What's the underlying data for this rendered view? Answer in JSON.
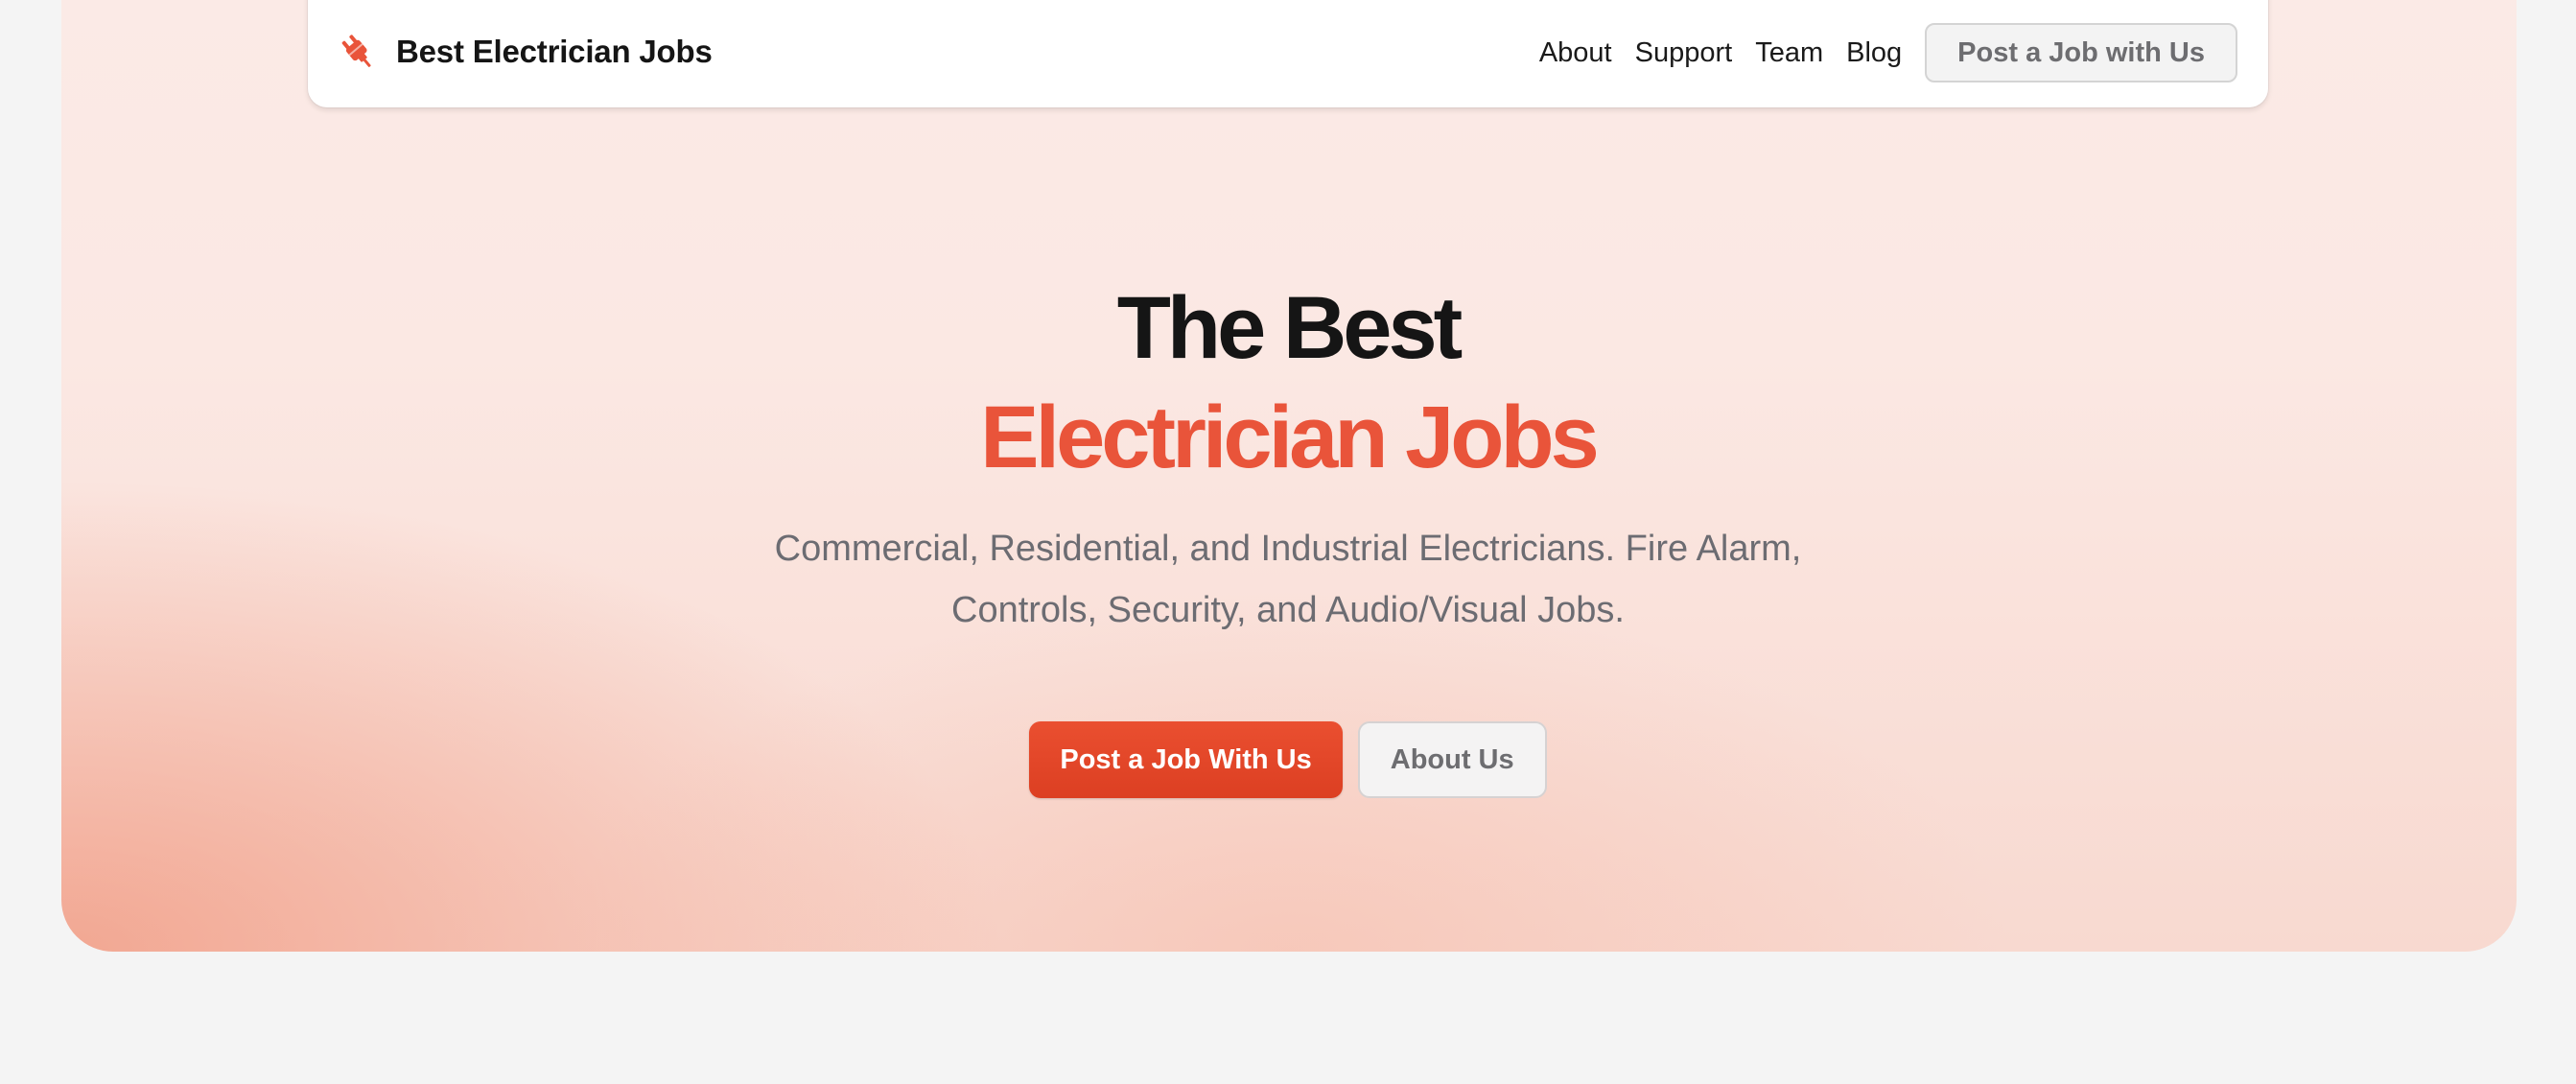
{
  "header": {
    "brand_name": "Best Electrician Jobs",
    "brand_icon": "electrical-plug-icon",
    "nav_links": [
      "About",
      "Support",
      "Team",
      "Blog"
    ],
    "cta_label": "Post a Job with Us"
  },
  "hero": {
    "title_line1": "The Best",
    "title_line2": "Electrician Jobs",
    "subtitle_line1": "Commercial, Residential, and Industrial Electricians. Fire Alarm,",
    "subtitle_line2": "Controls, Security, and Audio/Visual Jobs.",
    "primary_cta": "Post a Job With Us",
    "secondary_cta": "About Us"
  },
  "colors": {
    "accent": "#e9543a",
    "page_background": "#f4f4f4",
    "text_dark": "#151515",
    "text_muted": "#6c6c72"
  }
}
